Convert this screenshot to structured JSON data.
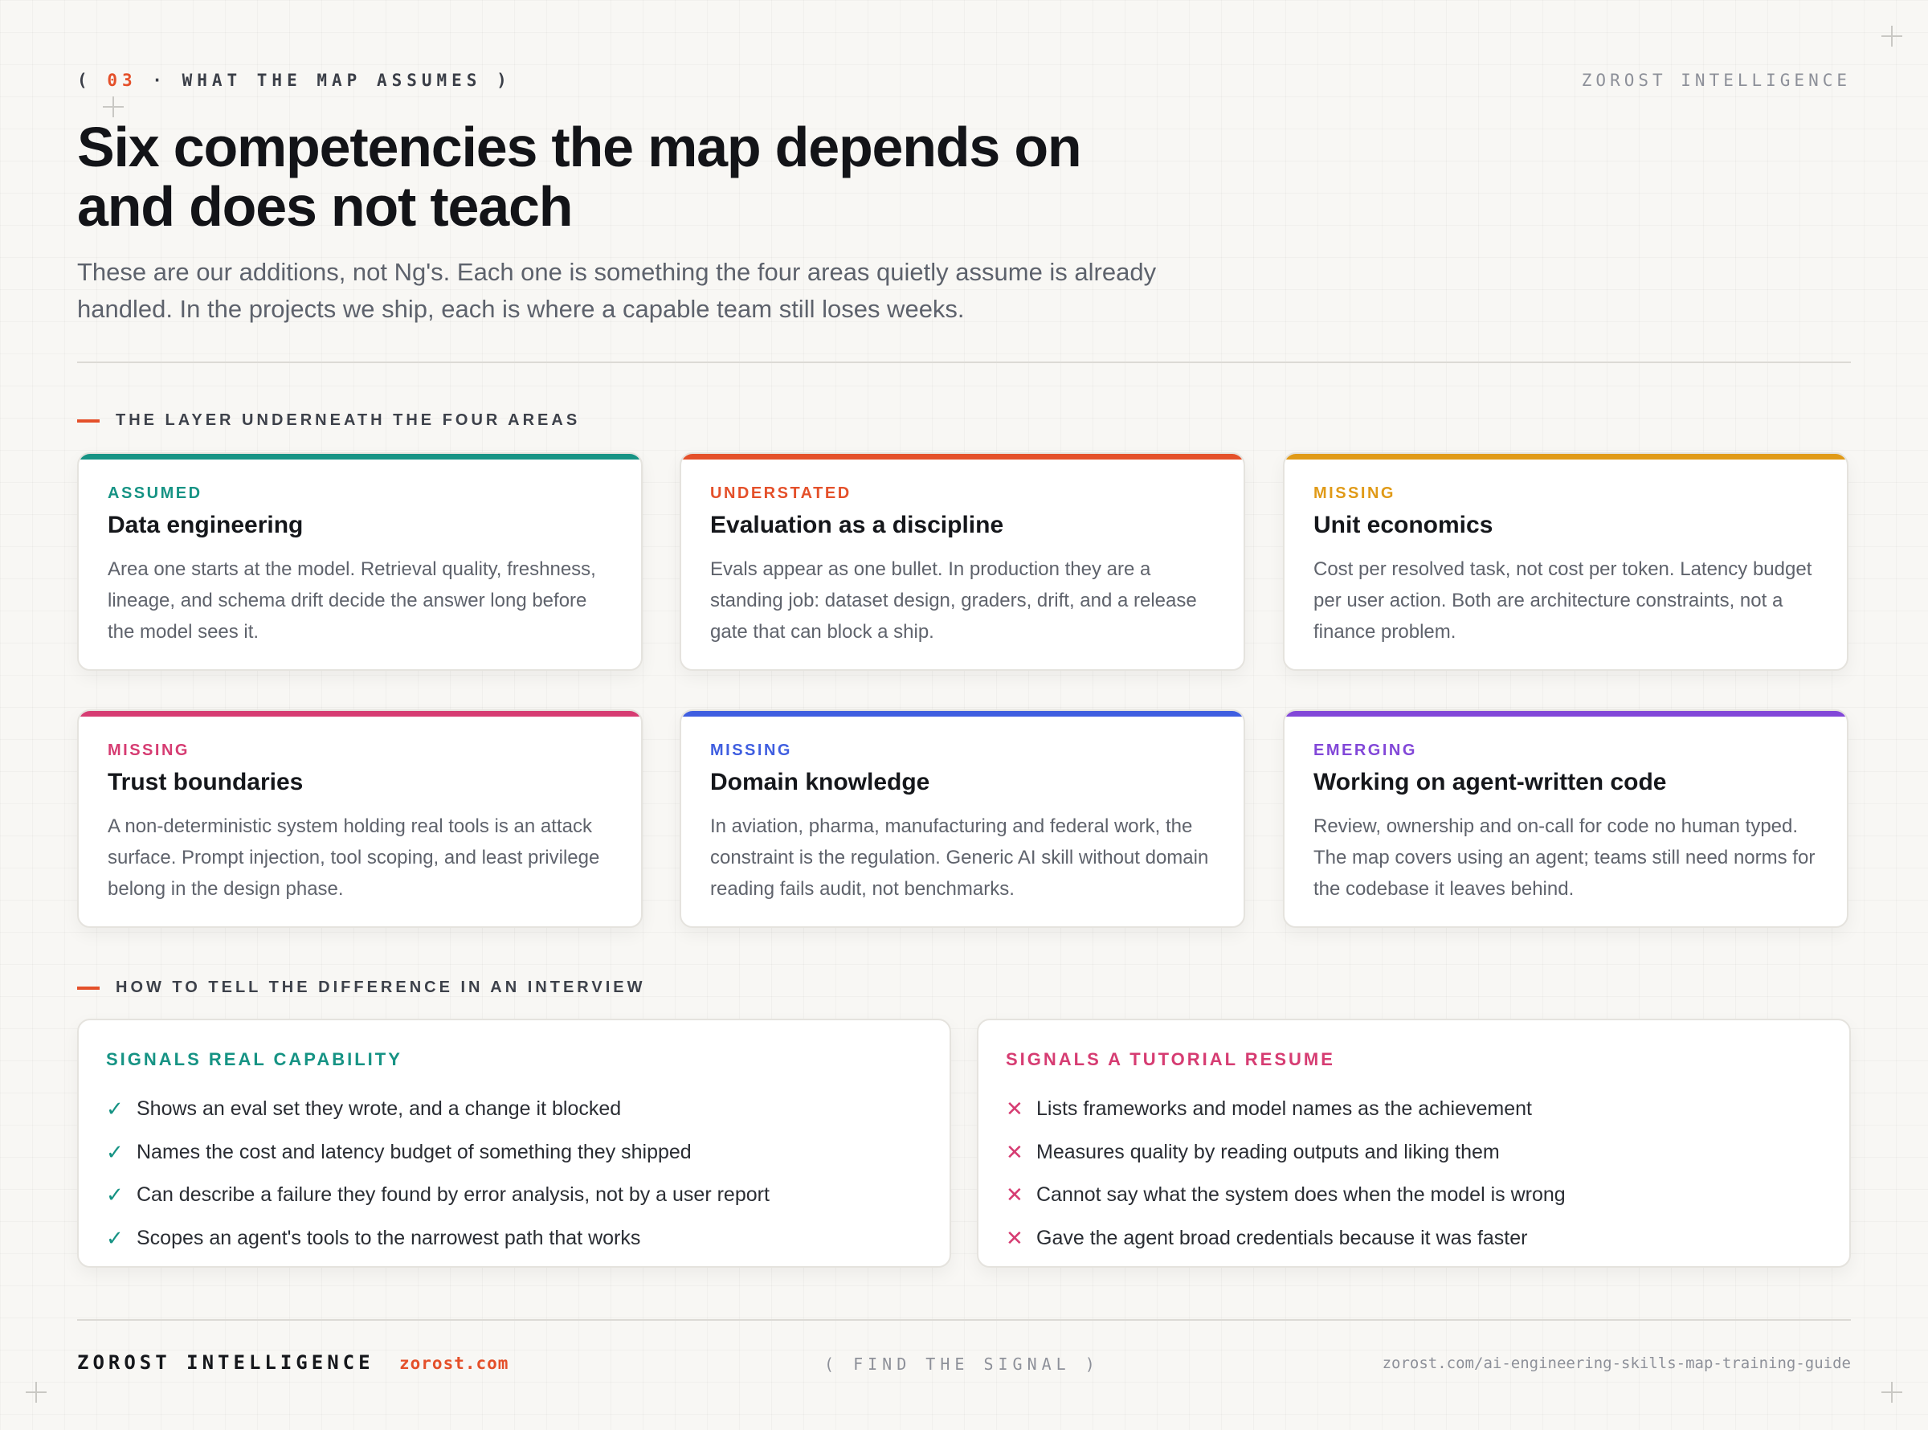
{
  "header": {
    "open_paren": "(",
    "section_number": "03",
    "separator": "·",
    "section_title": "WHAT THE MAP ASSUMES",
    "close_paren": ")",
    "brand": "ZOROST INTELLIGENCE"
  },
  "title": "Six competencies the map depends on and does not teach",
  "subtitle": "These are our additions, not Ng's. Each one is something the four areas quietly assume is already handled. In the projects we ship, each is where a capable team still loses weeks.",
  "layer_section": {
    "label": "THE LAYER UNDERNEATH THE FOUR AREAS",
    "cards": [
      {
        "tag": "ASSUMED",
        "title": "Data engineering",
        "body": "Area one starts at the model. Retrieval quality, freshness, lineage, and schema drift decide the answer long before the model sees it.",
        "color": "#169384"
      },
      {
        "tag": "UNDERSTATED",
        "title": "Evaluation as a discipline",
        "body": "Evals appear as one bullet. In production they are a standing job: dataset design, graders, drift, and a release gate that can block a ship.",
        "color": "#e4502a"
      },
      {
        "tag": "MISSING",
        "title": "Unit economics",
        "body": "Cost per resolved task, not cost per token. Latency budget per user action. Both are architecture constraints, not a finance problem.",
        "color": "#e09a17"
      },
      {
        "tag": "MISSING",
        "title": "Trust boundaries",
        "body": "A non-deterministic system holding real tools is an attack surface. Prompt injection, tool scoping, and least privilege belong in the design phase.",
        "color": "#d63c72"
      },
      {
        "tag": "MISSING",
        "title": "Domain knowledge",
        "body": "In aviation, pharma, manufacturing and federal work, the constraint is the regulation. Generic AI skill without domain reading fails audit, not benchmarks.",
        "color": "#3f5ee0"
      },
      {
        "tag": "EMERGING",
        "title": "Working on agent-written code",
        "body": "Review, ownership and on-call for code no human typed. The map covers using an agent; teams still need norms for the codebase it leaves behind.",
        "color": "#8247d8"
      }
    ]
  },
  "interview_section": {
    "label": "HOW TO TELL THE DIFFERENCE IN AN INTERVIEW",
    "good": {
      "title": "SIGNALS REAL CAPABILITY",
      "mark": "✓",
      "items": [
        "Shows an eval set they wrote, and a change it blocked",
        "Names the cost and latency budget of something they shipped",
        "Can describe a failure they found by error analysis, not by a user report",
        "Scopes an agent's tools to the narrowest path that works"
      ]
    },
    "bad": {
      "title": "SIGNALS A TUTORIAL RESUME",
      "mark": "✕",
      "items": [
        "Lists frameworks and model names as the achievement",
        "Measures quality by reading outputs and liking them",
        "Cannot say what the system does when the model is wrong",
        "Gave the agent broad credentials because it was faster"
      ]
    }
  },
  "footer": {
    "brand": "ZOROST INTELLIGENCE",
    "url": "zorost.com",
    "tagline": "( FIND THE SIGNAL )",
    "link": "zorost.com/ai-engineering-skills-map-training-guide"
  }
}
